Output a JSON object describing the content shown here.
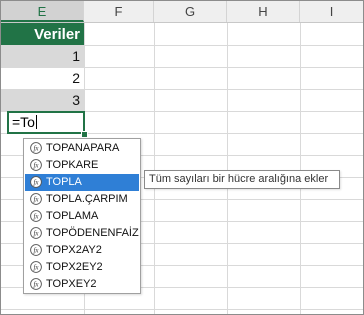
{
  "columns": [
    {
      "label": "E",
      "active": true
    },
    {
      "label": "F",
      "active": false
    },
    {
      "label": "G",
      "active": false
    },
    {
      "label": "H",
      "active": false
    },
    {
      "label": "I",
      "active": false
    }
  ],
  "table": {
    "header": "Veriler",
    "values": [
      "1",
      "2",
      "3"
    ],
    "accent_color": "#217346"
  },
  "edit_cell": {
    "value": "=To"
  },
  "autocomplete": {
    "items": [
      {
        "label": "TOPANAPARA",
        "icon": "function-icon"
      },
      {
        "label": "TOPKARE",
        "icon": "function-icon"
      },
      {
        "label": "TOPLA",
        "icon": "function-icon",
        "selected": true
      },
      {
        "label": "TOPLA.ÇARPIM",
        "icon": "function-icon"
      },
      {
        "label": "TOPLAMA",
        "icon": "function-icon"
      },
      {
        "label": "TOPÖDENENFAİZ",
        "icon": "function-icon"
      },
      {
        "label": "TOPX2AY2",
        "icon": "function-icon"
      },
      {
        "label": "TOPX2EY2",
        "icon": "function-icon"
      },
      {
        "label": "TOPXEY2",
        "icon": "function-icon"
      }
    ],
    "selected_color": "#2f7fd6"
  },
  "tooltip": {
    "text": "Tüm sayıları bir hücre aralığına ekler"
  }
}
